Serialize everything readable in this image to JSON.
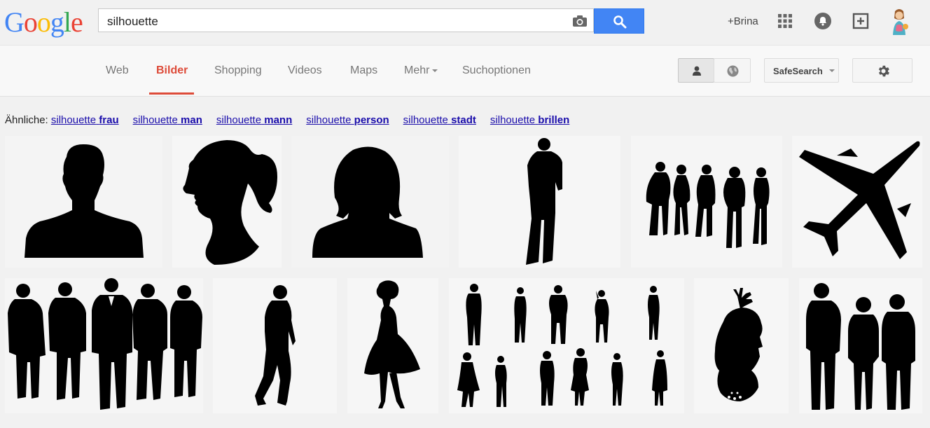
{
  "logo": {
    "letters": [
      "G",
      "o",
      "o",
      "g",
      "l",
      "e"
    ],
    "colors": [
      "#4285f4",
      "#ea4335",
      "#fbbc05",
      "#4285f4",
      "#34a853",
      "#ea4335"
    ]
  },
  "search": {
    "query": "silhouette",
    "button_icon": "search-icon",
    "camera_icon": "camera-icon"
  },
  "user": {
    "name": "+Brina"
  },
  "header_icons": [
    "apps-grid-icon",
    "notifications-icon",
    "share-add-icon",
    "avatar"
  ],
  "tabs": [
    {
      "label": "Web",
      "active": false
    },
    {
      "label": "Bilder",
      "active": true
    },
    {
      "label": "Shopping",
      "active": false
    },
    {
      "label": "Videos",
      "active": false
    },
    {
      "label": "Maps",
      "active": false
    },
    {
      "label": "Mehr",
      "active": false
    },
    {
      "label": "Suchoptionen",
      "active": false
    }
  ],
  "toolbar": {
    "safesearch_label": "SafeSearch",
    "personal_icon": "person-icon",
    "global_icon": "globe-icon",
    "settings_icon": "gear-icon"
  },
  "related": {
    "prefix": "Ähnliche:",
    "items": [
      {
        "base": "silhouette",
        "bold": "frau"
      },
      {
        "base": "silhouette",
        "bold": "man"
      },
      {
        "base": "silhouette",
        "bold": "mann"
      },
      {
        "base": "silhouette",
        "bold": "person"
      },
      {
        "base": "silhouette",
        "bold": "stadt"
      },
      {
        "base": "silhouette",
        "bold": "brillen"
      }
    ]
  },
  "results": {
    "row1": [
      "man-head-silhouette",
      "woman-ponytail-silhouette",
      "woman-head-silhouette",
      "standing-man-silhouette",
      "group-of-people-silhouette",
      "airplane-silhouette"
    ],
    "row2": [
      "businessmen-silhouette",
      "walking-man-silhouette",
      "dancing-woman-silhouette",
      "people-collection-silhouette",
      "girl-antlers-silhouette",
      "three-people-silhouette"
    ]
  },
  "colors": {
    "accent_red": "#dd4b39",
    "link_blue": "#1a0dab",
    "search_blue": "#4285f4"
  }
}
